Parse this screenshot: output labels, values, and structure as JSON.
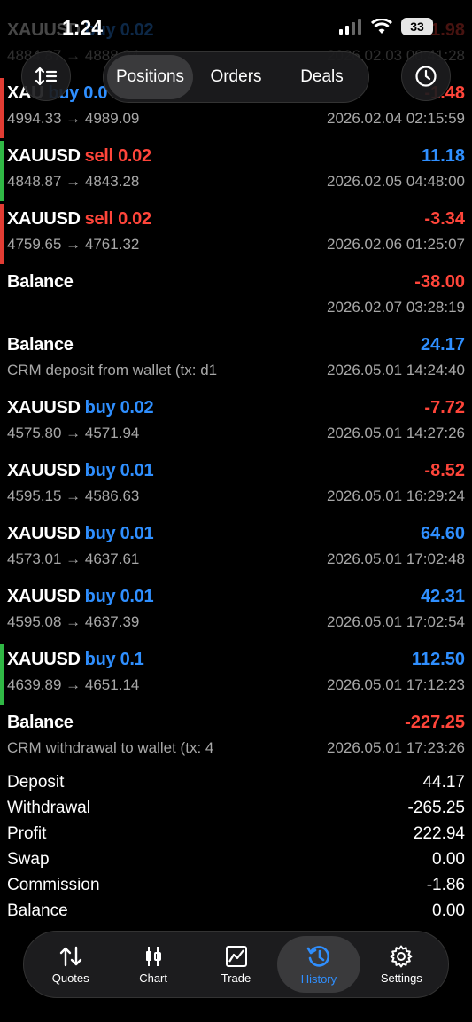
{
  "status": {
    "time": "1:24",
    "battery": "33"
  },
  "tabs": [
    {
      "label": "Positions",
      "active": true
    },
    {
      "label": "Orders",
      "active": false
    },
    {
      "label": "Deals",
      "active": false
    }
  ],
  "partial_rows": [
    {
      "symbol": "XAUUSD",
      "side": "buy 0.02",
      "value": "-1.98",
      "prices": "4884.87 → 4888.24",
      "time": "2026.02.03 00:41:28"
    }
  ],
  "rows": [
    {
      "symbol": "XAU",
      "side": "buy 0.0",
      "side_color": "blue",
      "value": "-1.48",
      "value_color": "red",
      "line2": "4994.33 → 4989.09",
      "time": "2026.02.04 02:15:59",
      "bar": "red"
    },
    {
      "symbol": "XAUUSD",
      "side": "sell 0.02",
      "side_color": "red",
      "value": "11.18",
      "value_color": "blue",
      "line2": "4848.87 → 4843.28",
      "time": "2026.02.05 04:48:00",
      "bar": "green"
    },
    {
      "symbol": "XAUUSD",
      "side": "sell 0.02",
      "side_color": "red",
      "value": "-3.34",
      "value_color": "red",
      "line2": "4759.65 → 4761.32",
      "time": "2026.02.06 01:25:07",
      "bar": "red"
    },
    {
      "symbol": "Balance",
      "side": "",
      "side_color": "blue",
      "value": "-38.00",
      "value_color": "red",
      "line2": "",
      "time": "2026.02.07 03:28:19",
      "bar": ""
    },
    {
      "symbol": "Balance",
      "side": "",
      "side_color": "blue",
      "value": "24.17",
      "value_color": "blue",
      "line2": "CRM deposit from wallet (tx: d1",
      "time": "2026.05.01 14:24:40",
      "bar": ""
    },
    {
      "symbol": "XAUUSD",
      "side": "buy 0.02",
      "side_color": "blue",
      "value": "-7.72",
      "value_color": "red",
      "line2": "4575.80 → 4571.94",
      "time": "2026.05.01 14:27:26",
      "bar": ""
    },
    {
      "symbol": "XAUUSD",
      "side": "buy 0.01",
      "side_color": "blue",
      "value": "-8.52",
      "value_color": "red",
      "line2": "4595.15 → 4586.63",
      "time": "2026.05.01 16:29:24",
      "bar": ""
    },
    {
      "symbol": "XAUUSD",
      "side": "buy 0.01",
      "side_color": "blue",
      "value": "64.60",
      "value_color": "blue",
      "line2": "4573.01 → 4637.61",
      "time": "2026.05.01 17:02:48",
      "bar": ""
    },
    {
      "symbol": "XAUUSD",
      "side": "buy 0.01",
      "side_color": "blue",
      "value": "42.31",
      "value_color": "blue",
      "line2": "4595.08 → 4637.39",
      "time": "2026.05.01 17:02:54",
      "bar": ""
    },
    {
      "symbol": "XAUUSD",
      "side": "buy 0.1",
      "side_color": "blue",
      "value": "112.50",
      "value_color": "blue",
      "line2": "4639.89 → 4651.14",
      "time": "2026.05.01 17:12:23",
      "bar": "green"
    },
    {
      "symbol": "Balance",
      "side": "",
      "side_color": "blue",
      "value": "-227.25",
      "value_color": "red",
      "line2": "CRM withdrawal to wallet (tx: 4",
      "time": "2026.05.01 17:23:26",
      "bar": ""
    }
  ],
  "summary": [
    {
      "label": "Deposit",
      "value": "44.17"
    },
    {
      "label": "Withdrawal",
      "value": "-265.25"
    },
    {
      "label": "Profit",
      "value": "222.94"
    },
    {
      "label": "Swap",
      "value": "0.00"
    },
    {
      "label": "Commission",
      "value": "-1.86"
    },
    {
      "label": "Balance",
      "value": "0.00"
    }
  ],
  "tabbar": [
    {
      "label": "Quotes",
      "icon": "quotes-icon",
      "active": false
    },
    {
      "label": "Chart",
      "icon": "chart-icon",
      "active": false
    },
    {
      "label": "Trade",
      "icon": "trade-icon",
      "active": false
    },
    {
      "label": "History",
      "icon": "history-icon",
      "active": true
    },
    {
      "label": "Settings",
      "icon": "settings-icon",
      "active": false
    }
  ],
  "colors": {
    "blue": "#2f8fff",
    "red": "#ff453a",
    "green_bar": "#30b845",
    "red_bar": "#e23c33"
  }
}
